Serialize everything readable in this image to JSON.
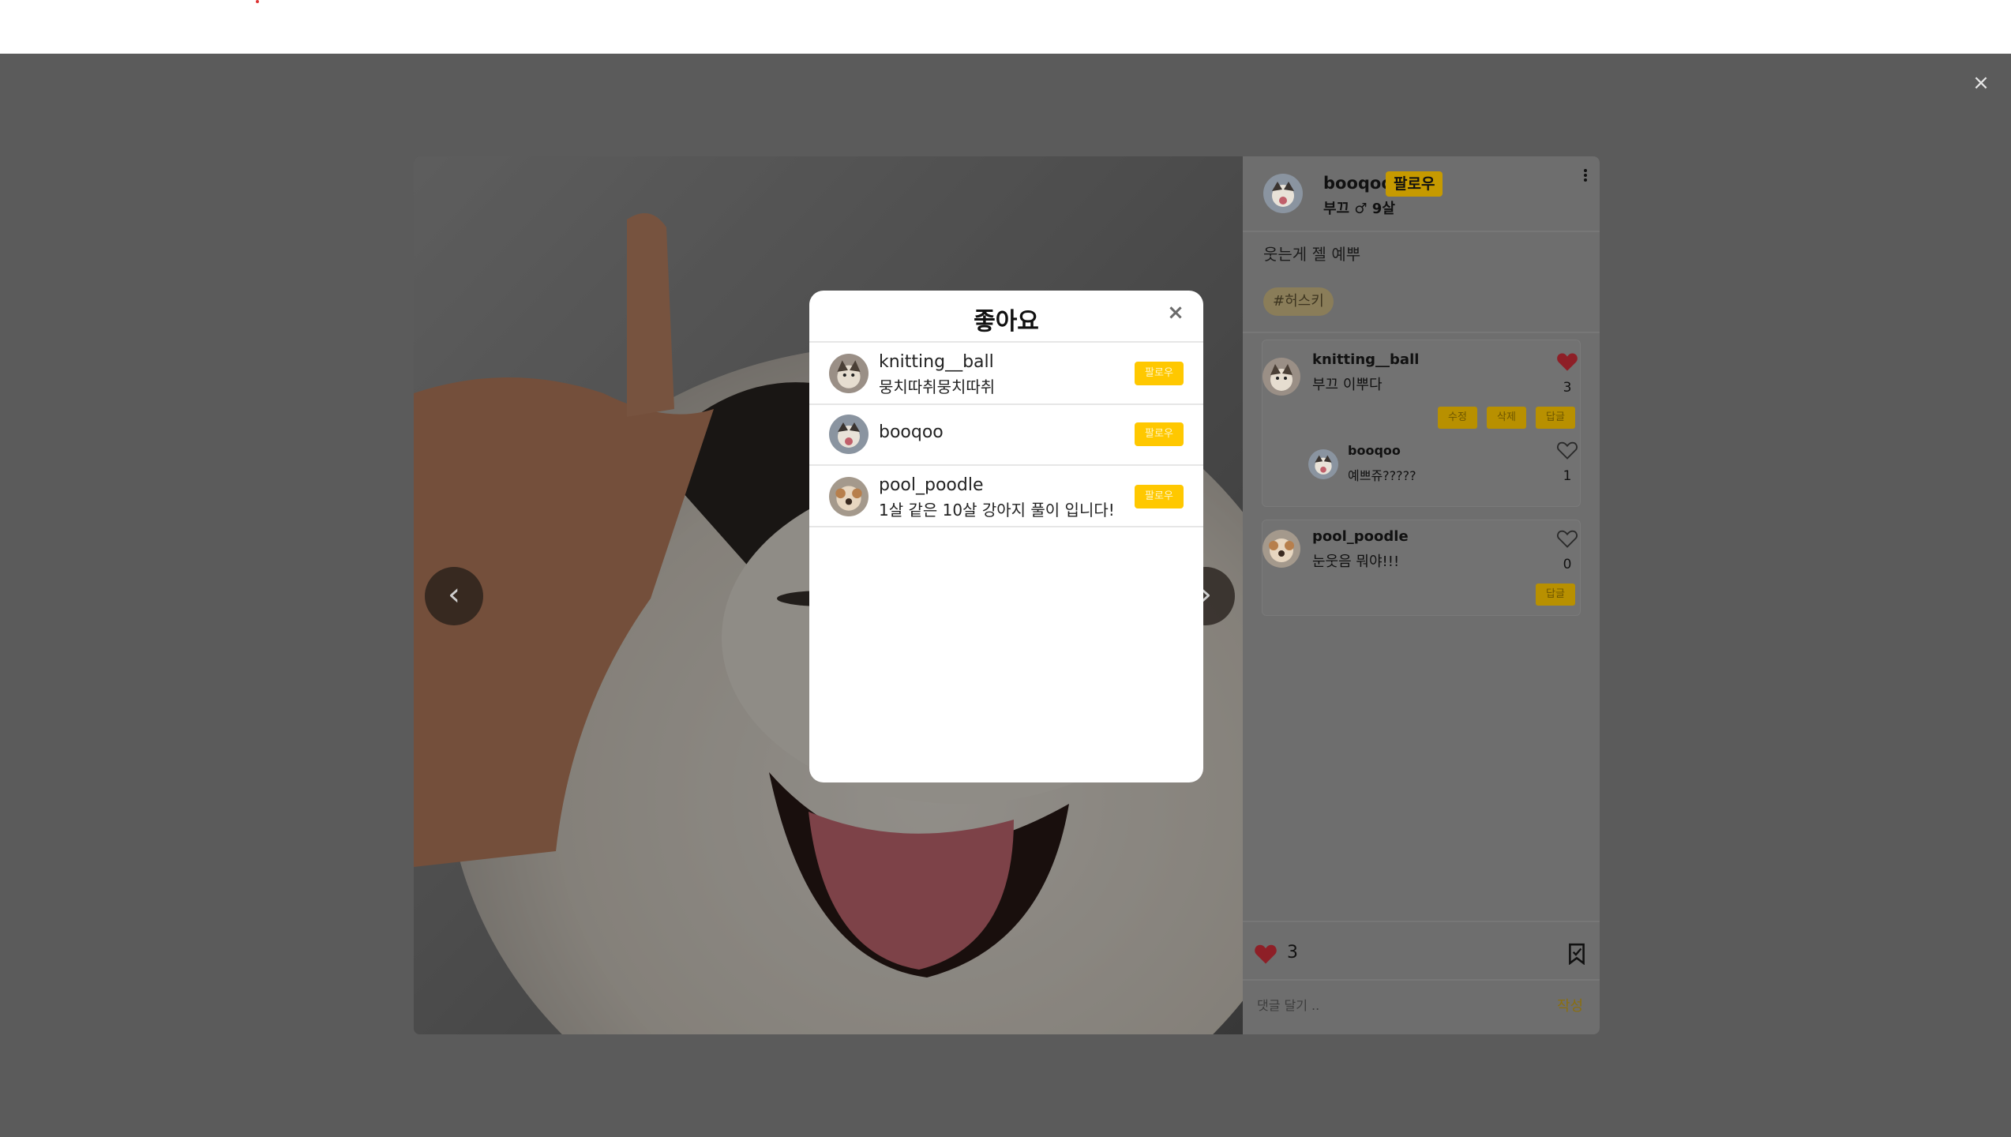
{
  "overlay": {
    "close_label": "×"
  },
  "post": {
    "author": {
      "username": "booqoo",
      "follow_label": "팔로우",
      "pet_info": "부끄 ♂ 9살"
    },
    "caption": "웃는게 젤 예뿌",
    "tags": [
      "#허스키"
    ],
    "nav": {
      "prev": "‹",
      "next": "›"
    },
    "comments": [
      {
        "username": "knitting__ball",
        "text": "부끄 이뿌다",
        "likes": "3",
        "liked": true,
        "actions": [
          "수정",
          "삭제",
          "답글"
        ],
        "replies": [
          {
            "username": "booqoo",
            "text": "예쁘쥬?????",
            "likes": "1",
            "liked": false
          }
        ]
      },
      {
        "username": "pool_poodle",
        "text": "눈웃음 뭐야!!!",
        "likes": "0",
        "liked": false,
        "actions": [
          "답글"
        ]
      }
    ],
    "like_count": "3",
    "comment_placeholder": "댓글 달기 ..",
    "submit_label": "작성"
  },
  "likes_modal": {
    "title": "좋아요",
    "close_label": "×",
    "users": [
      {
        "username": "knitting__ball",
        "subtitle": "뭉치따취뭉치따취",
        "follow_label": "팔로우"
      },
      {
        "username": "booqoo",
        "subtitle": "",
        "follow_label": "팔로우"
      },
      {
        "username": "pool_poodle",
        "subtitle": "1살 같은 10살 강아지 풀이 입니다!",
        "follow_label": "팔로우"
      }
    ]
  },
  "colors": {
    "accent": "#ffc800",
    "like_red": "#d0303a",
    "overlay": "#5b5b5b"
  }
}
